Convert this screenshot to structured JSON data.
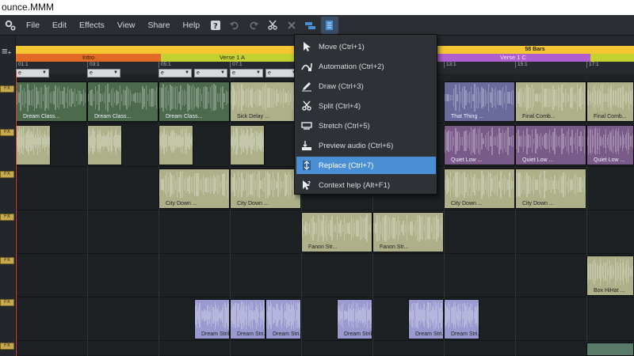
{
  "window": {
    "title": "ounce.MMM"
  },
  "menu": [
    "File",
    "Edit",
    "Effects",
    "View",
    "Share",
    "Help"
  ],
  "toolbar": {
    "icons": [
      "help-icon",
      "undo-icon",
      "redo-icon",
      "scissors-icon",
      "delete-icon",
      "edit-mode-icon",
      "mode-dropdown-icon"
    ]
  },
  "ruler": {
    "bars_label": "58 Bars",
    "sections": [
      {
        "label": "Intro",
        "color": "#e06a26"
      },
      {
        "label": "Verse 1 A",
        "color": "#c2d230"
      },
      {
        "label": "Verse 1 C",
        "color": "#b05fd0"
      }
    ],
    "ticks": [
      "01:1",
      "03:1",
      "05:1",
      "07:1",
      "13:1",
      "15:1",
      "17:1"
    ],
    "dropdowns": [
      "e",
      "e",
      "e",
      "e",
      "e",
      "e"
    ]
  },
  "tracks": [
    {
      "fx": "FX",
      "clips": [
        "Dream Class...",
        "Dream Class...",
        "Dream Class...",
        "Sick Delay ...",
        "That Thing ...",
        "Final Comb...",
        "Final Comb..."
      ]
    },
    {
      "fx": "FX",
      "clips": [
        "Quiet Low ...",
        "Quiet Low ...",
        "Quiet Low ..."
      ]
    },
    {
      "fx": "FX",
      "clips": [
        "City Down ...",
        "City Down ...",
        "City Down ...",
        "City Down ..."
      ]
    },
    {
      "fx": "FX",
      "clips": [
        "Fanon Str...",
        "Fanon Str..."
      ]
    },
    {
      "fx": "FX",
      "clips": [
        "Box HiHat ..."
      ]
    },
    {
      "fx": "FX",
      "clips": [
        "Dream Strik...",
        "Dream Stri...",
        "Dream Stri...",
        "Dream Strik...",
        "Dream Stri...",
        "Dream Stri..."
      ]
    },
    {
      "fx": "FX",
      "clips": []
    }
  ],
  "context_menu": [
    {
      "label": "Move (Ctrl+1)",
      "icon": "cursor-icon"
    },
    {
      "label": "Automation (Ctrl+2)",
      "icon": "automation-icon"
    },
    {
      "label": "Draw (Ctrl+3)",
      "icon": "pencil-icon"
    },
    {
      "label": "Split (Ctrl+4)",
      "icon": "scissors-icon"
    },
    {
      "label": "Stretch (Ctrl+5)",
      "icon": "stretch-icon"
    },
    {
      "label": "Preview audio (Ctrl+6)",
      "icon": "speaker-icon"
    },
    {
      "label": "Replace (Ctrl+7)",
      "icon": "replace-icon",
      "selected": true
    },
    {
      "label": "Context help (Alt+F1)",
      "icon": "context-help-icon"
    }
  ],
  "colors": {
    "green_clip": "#4c6a4c",
    "olive_clip": "#aeb08a",
    "purple_clip": "#7a5a88",
    "lavender_clip": "#9a9ad0",
    "selected": "#4a8fd3"
  }
}
